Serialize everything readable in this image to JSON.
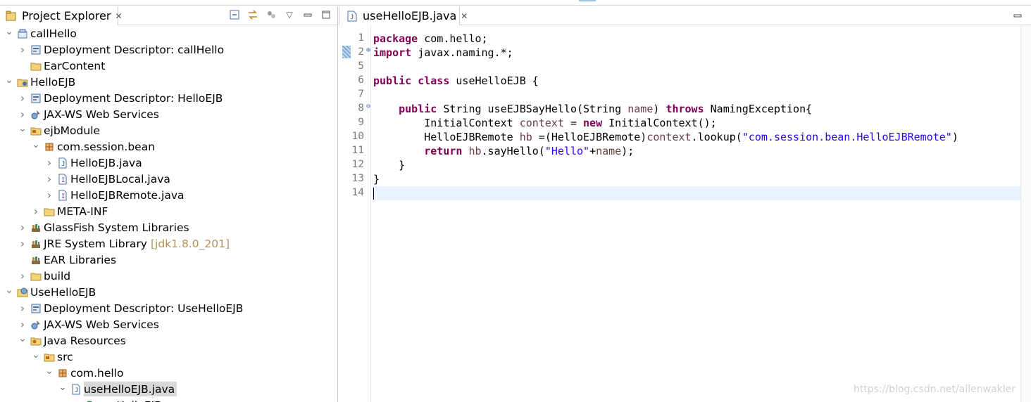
{
  "explorer": {
    "title": "Project Explorer",
    "tree": [
      {
        "indent": 0,
        "twisty": "expanded",
        "icon": "ear-project-icon",
        "label": "callHello"
      },
      {
        "indent": 1,
        "twisty": "collapsed",
        "icon": "deployment-descriptor-icon",
        "label": "Deployment Descriptor: callHello"
      },
      {
        "indent": 1,
        "twisty": "none",
        "icon": "folder-icon",
        "label": "EarContent"
      },
      {
        "indent": 0,
        "twisty": "expanded",
        "icon": "ejb-project-icon",
        "label": "HelloEJB"
      },
      {
        "indent": 1,
        "twisty": "collapsed",
        "icon": "deployment-descriptor-icon",
        "label": "Deployment Descriptor: HelloEJB"
      },
      {
        "indent": 1,
        "twisty": "collapsed",
        "icon": "web-services-icon",
        "label": "JAX-WS Web Services"
      },
      {
        "indent": 1,
        "twisty": "expanded",
        "icon": "source-folder-icon",
        "label": "ejbModule"
      },
      {
        "indent": 2,
        "twisty": "expanded",
        "icon": "package-icon",
        "label": "com.session.bean"
      },
      {
        "indent": 3,
        "twisty": "collapsed",
        "icon": "java-file-icon",
        "label": "HelloEJB.java"
      },
      {
        "indent": 3,
        "twisty": "collapsed",
        "icon": "java-interface-file-icon",
        "label": "HelloEJBLocal.java"
      },
      {
        "indent": 3,
        "twisty": "collapsed",
        "icon": "java-interface-file-icon",
        "label": "HelloEJBRemote.java"
      },
      {
        "indent": 2,
        "twisty": "collapsed",
        "icon": "folder-icon",
        "label": "META-INF"
      },
      {
        "indent": 1,
        "twisty": "collapsed",
        "icon": "library-icon",
        "label": "GlassFish System Libraries"
      },
      {
        "indent": 1,
        "twisty": "collapsed",
        "icon": "library-icon",
        "label": "JRE System Library",
        "decoration": "[jdk1.8.0_201]"
      },
      {
        "indent": 1,
        "twisty": "none",
        "icon": "library-icon",
        "label": "EAR Libraries"
      },
      {
        "indent": 1,
        "twisty": "collapsed",
        "icon": "folder-icon",
        "label": "build"
      },
      {
        "indent": 0,
        "twisty": "expanded",
        "icon": "web-project-icon",
        "label": "UseHelloEJB"
      },
      {
        "indent": 1,
        "twisty": "collapsed",
        "icon": "deployment-descriptor-icon",
        "label": "Deployment Descriptor: UseHelloEJB"
      },
      {
        "indent": 1,
        "twisty": "collapsed",
        "icon": "web-services-icon",
        "label": "JAX-WS Web Services"
      },
      {
        "indent": 1,
        "twisty": "expanded",
        "icon": "java-resources-icon",
        "label": "Java Resources"
      },
      {
        "indent": 2,
        "twisty": "expanded",
        "icon": "source-folder-icon",
        "label": "src"
      },
      {
        "indent": 3,
        "twisty": "expanded",
        "icon": "package-icon",
        "label": "com.hello"
      },
      {
        "indent": 4,
        "twisty": "expanded",
        "icon": "java-file-icon",
        "label": "useHelloEJB.java",
        "selected": true
      },
      {
        "indent": 5,
        "twisty": "none",
        "icon": "class-icon",
        "label": "useHelloEJB"
      }
    ]
  },
  "editor": {
    "tab_title": "useHelloEJB.java",
    "lines": [
      {
        "num": "1",
        "tokens": [
          [
            "kw",
            "package"
          ],
          [
            "t",
            " com.hello;"
          ]
        ]
      },
      {
        "num": "2",
        "fold": "⊕",
        "tokens": [
          [
            "kw",
            "import"
          ],
          [
            "t",
            " javax.naming.*;"
          ]
        ]
      },
      {
        "num": "5",
        "tokens": []
      },
      {
        "num": "6",
        "tokens": [
          [
            "kw",
            "public"
          ],
          [
            "t",
            " "
          ],
          [
            "kw",
            "class"
          ],
          [
            "t",
            " useHelloEJB {"
          ]
        ]
      },
      {
        "num": "7",
        "tokens": []
      },
      {
        "num": "8",
        "fold": "⊖",
        "tokens": [
          [
            "t",
            "    "
          ],
          [
            "kw",
            "public"
          ],
          [
            "t",
            " String useEJBSayHello(String "
          ],
          [
            "var",
            "name"
          ],
          [
            "t",
            ") "
          ],
          [
            "kw",
            "throws"
          ],
          [
            "t",
            " NamingException{"
          ]
        ]
      },
      {
        "num": "9",
        "tokens": [
          [
            "t",
            "        InitialContext "
          ],
          [
            "var",
            "context"
          ],
          [
            "t",
            " = "
          ],
          [
            "kw",
            "new"
          ],
          [
            "t",
            " InitialContext();"
          ]
        ]
      },
      {
        "num": "10",
        "tokens": [
          [
            "t",
            "        HelloEJBRemote "
          ],
          [
            "var",
            "hb"
          ],
          [
            "t",
            " =(HelloEJBRemote)"
          ],
          [
            "var",
            "context"
          ],
          [
            "t",
            ".lookup("
          ],
          [
            "str",
            "\"com.session.bean.HelloEJBRemote\""
          ],
          [
            "t",
            ")"
          ]
        ]
      },
      {
        "num": "11",
        "tokens": [
          [
            "t",
            "        "
          ],
          [
            "kw",
            "return"
          ],
          [
            "t",
            " "
          ],
          [
            "var",
            "hb"
          ],
          [
            "t",
            ".sayHello("
          ],
          [
            "str",
            "\"Hello\""
          ],
          [
            "t",
            "+"
          ],
          [
            "var",
            "name"
          ],
          [
            "t",
            ");"
          ]
        ]
      },
      {
        "num": "12",
        "tokens": [
          [
            "t",
            "    }"
          ]
        ]
      },
      {
        "num": "13",
        "tokens": [
          [
            "t",
            "}"
          ]
        ]
      },
      {
        "num": "14",
        "tokens": [],
        "current": true
      }
    ]
  },
  "watermark": "https://blog.csdn.net/allenwakler",
  "colors": {
    "keyword": "#7f0055",
    "variable": "#6a3e3e",
    "string": "#2a00ff",
    "selection": "#d9d9d9",
    "current_line": "#e8f2fe"
  }
}
